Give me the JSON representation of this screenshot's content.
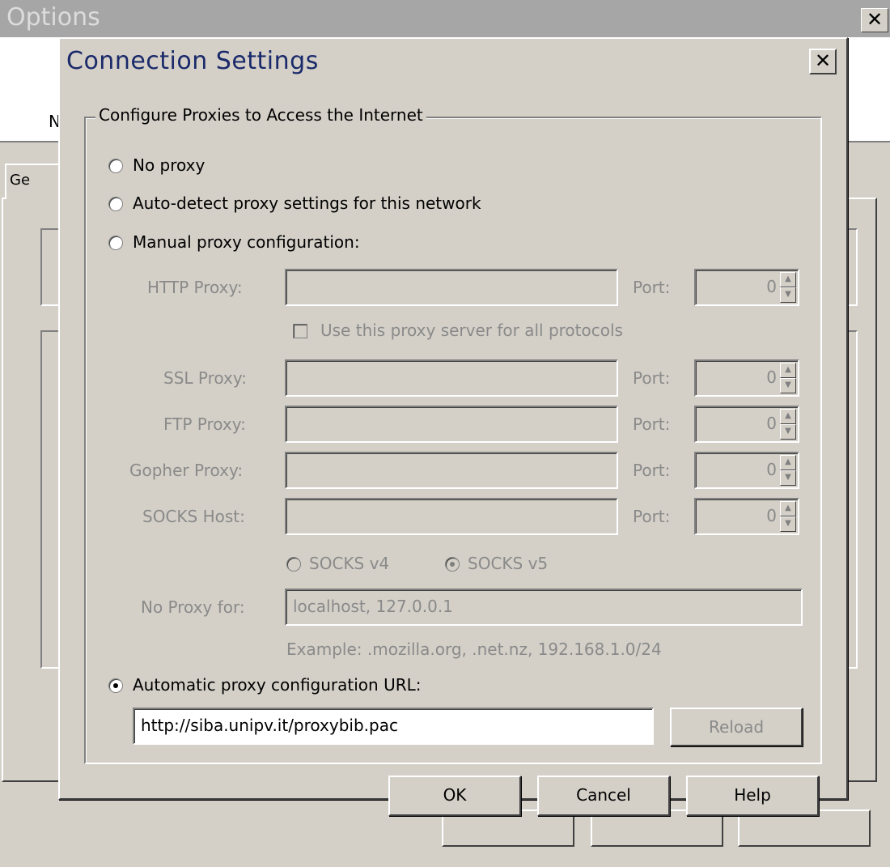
{
  "options_window": {
    "title": "Options",
    "close_glyph": "✕",
    "header_letter": "N",
    "tab_label": "Ge"
  },
  "dialog": {
    "title": "Connection Settings",
    "close_glyph": "✕",
    "group_title": "Configure Proxies to Access the Internet",
    "radios": {
      "no_proxy": {
        "label": "No proxy",
        "selected": false
      },
      "auto_detect": {
        "label": "Auto-detect proxy settings for this network",
        "selected": false
      },
      "manual": {
        "label": "Manual proxy configuration:",
        "selected": false
      },
      "auto_url": {
        "label": "Automatic proxy configuration URL:",
        "selected": true
      }
    },
    "proxies": [
      {
        "label": "HTTP Proxy:",
        "value": "",
        "port_label": "Port:",
        "port": "0"
      },
      {
        "label": "SSL Proxy:",
        "value": "",
        "port_label": "Port:",
        "port": "0"
      },
      {
        "label": "FTP Proxy:",
        "value": "",
        "port_label": "Port:",
        "port": "0"
      },
      {
        "label": "Gopher Proxy:",
        "value": "",
        "port_label": "Port:",
        "port": "0"
      },
      {
        "label": "SOCKS Host:",
        "value": "",
        "port_label": "Port:",
        "port": "0"
      }
    ],
    "use_same_proxy": {
      "label": "Use this proxy server for all protocols",
      "checked": false
    },
    "socks_versions": {
      "v4": {
        "label": "SOCKS v4",
        "selected": false
      },
      "v5": {
        "label": "SOCKS v5",
        "selected": true
      }
    },
    "no_proxy_for": {
      "label": "No Proxy for:",
      "value": "localhost, 127.0.0.1",
      "example": "Example: .mozilla.org, .net.nz, 192.168.1.0/24"
    },
    "auto_url_value": "http://siba.unipv.it/proxybib.pac",
    "reload_label": "Reload",
    "buttons": {
      "ok": "OK",
      "cancel": "Cancel",
      "help": "Help"
    }
  }
}
